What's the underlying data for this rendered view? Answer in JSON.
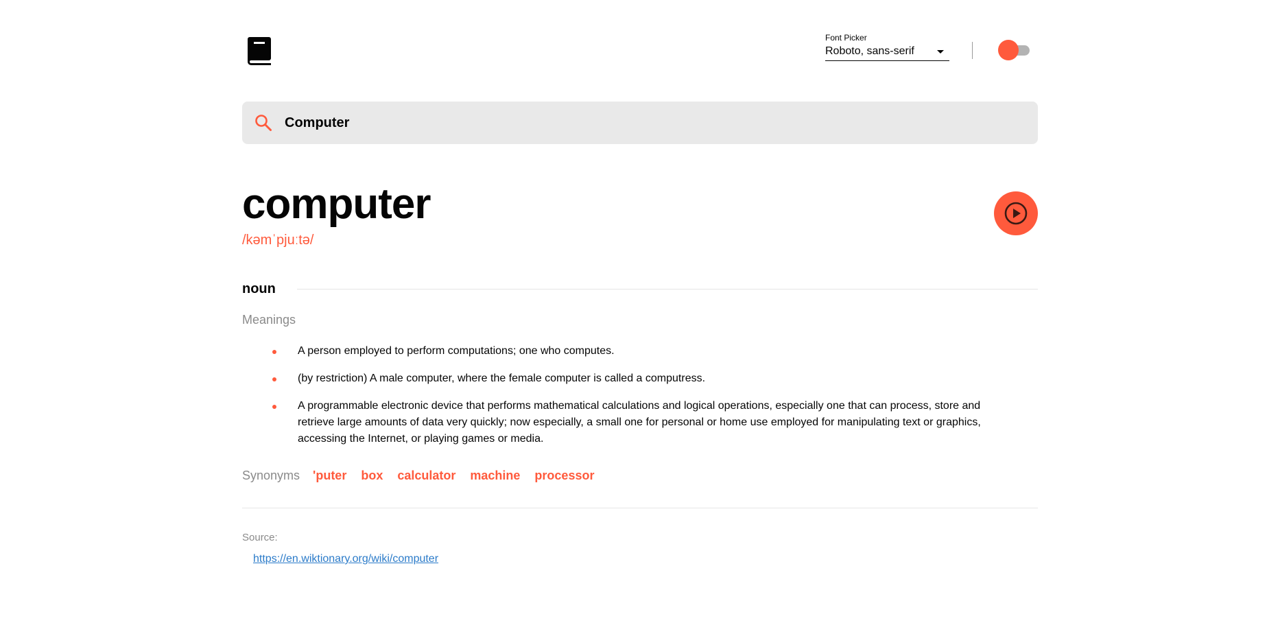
{
  "header": {
    "logo": "book-icon",
    "font_picker": {
      "label": "Font Picker",
      "selected": "Roboto, sans-serif"
    },
    "theme_toggle": {
      "state": "light"
    }
  },
  "search": {
    "value": "Computer",
    "icon": "search-icon"
  },
  "entry": {
    "word": "computer",
    "phonetic": "/kəmˈpjuːtə/",
    "part_of_speech": "noun",
    "meanings_label": "Meanings",
    "meanings": [
      "A person employed to perform computations; one who computes.",
      "(by restriction) A male computer, where the female computer is called a computress.",
      "A programmable electronic device that performs mathematical calculations and logical operations, especially one that can process, store and retrieve large amounts of data very quickly; now especially, a small one for personal or home use employed for manipulating text or graphics, accessing the Internet, or playing games or media."
    ],
    "synonyms_label": "Synonyms",
    "synonyms": [
      "'puter",
      "box",
      "calculator",
      "machine",
      "processor"
    ]
  },
  "source": {
    "label": "Source:",
    "url": "https://en.wiktionary.org/wiki/computer"
  },
  "colors": {
    "accent": "#ff5a3c",
    "muted": "#8a8a8a",
    "link": "#2b7bc9",
    "search_bg": "#e9e9e9"
  }
}
